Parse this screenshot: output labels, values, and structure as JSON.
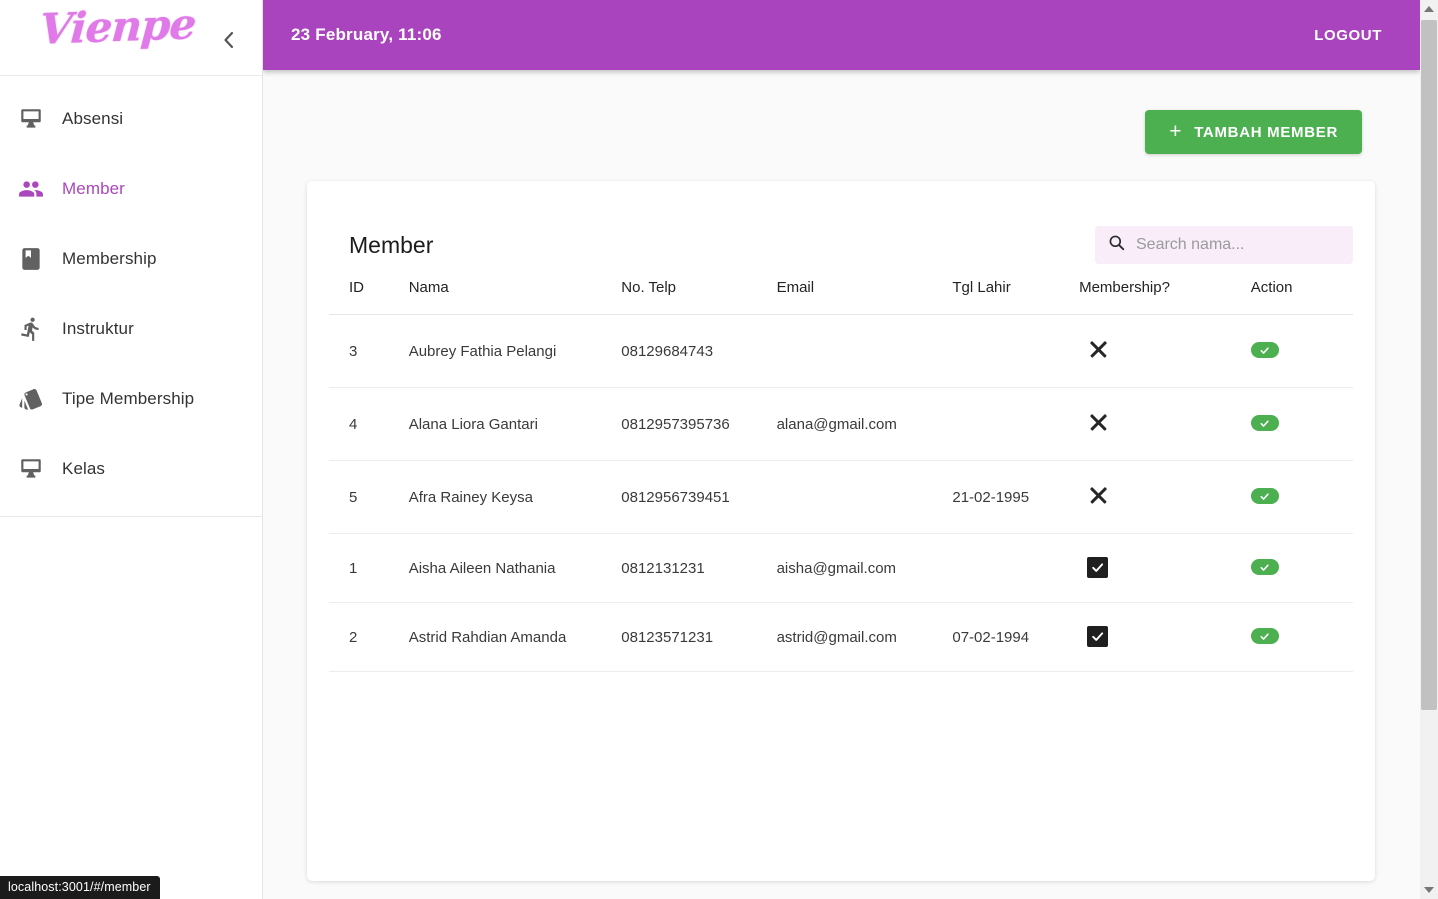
{
  "sidebar": {
    "logo_text": "Vienpe",
    "collapse_icon": "chevron-left-icon",
    "items": [
      {
        "label": "Absensi",
        "icon": "desktop-icon",
        "active": false
      },
      {
        "label": "Member",
        "icon": "people-icon",
        "active": true
      },
      {
        "label": "Membership",
        "icon": "book-icon",
        "active": false
      },
      {
        "label": "Instruktur",
        "icon": "running-icon",
        "active": false
      },
      {
        "label": "Tipe Membership",
        "icon": "layers-icon",
        "active": false
      },
      {
        "label": "Kelas",
        "icon": "desktop-icon",
        "active": false
      }
    ]
  },
  "topbar": {
    "datetime": "23 February,  11:06",
    "logout_label": "LOGOUT",
    "background_color": "#a944be"
  },
  "toolbar": {
    "add_member_label": "TAMBAH MEMBER",
    "add_member_icon": "plus-icon",
    "add_member_color": "#4caf50"
  },
  "card": {
    "title": "Member",
    "search": {
      "placeholder": "Search nama...",
      "value": "",
      "icon": "search-icon"
    },
    "table": {
      "headers": [
        "ID",
        "Nama",
        "No. Telp",
        "Email",
        "Tgl Lahir",
        "Membership?",
        "Action"
      ],
      "rows": [
        {
          "id": "3",
          "nama": "Aubrey Fathia Pelangi",
          "telp": "08129684743",
          "email": "",
          "tgl_lahir": "",
          "membership": false
        },
        {
          "id": "4",
          "nama": "Alana Liora Gantari",
          "telp": "0812957395736",
          "email": "alana@gmail.com",
          "tgl_lahir": "",
          "membership": false
        },
        {
          "id": "5",
          "nama": "Afra Rainey Keysa",
          "telp": "0812956739451",
          "email": "",
          "tgl_lahir": "21-02-1995",
          "membership": false
        },
        {
          "id": "1",
          "nama": "Aisha Aileen Nathania",
          "telp": "0812131231",
          "email": "aisha@gmail.com",
          "tgl_lahir": "",
          "membership": true
        },
        {
          "id": "2",
          "nama": "Astrid Rahdian Amanda",
          "telp": "08123571231",
          "email": "astrid@gmail.com",
          "tgl_lahir": "07-02-1994",
          "membership": true
        }
      ]
    }
  },
  "status_bar": {
    "url": "localhost:3001/#/member"
  },
  "colors": {
    "accent_purple": "#ab47bc",
    "header_purple": "#a944be",
    "logo_pink": "#e07ae8",
    "success_green": "#4caf50",
    "search_bg": "#f8edf8"
  }
}
